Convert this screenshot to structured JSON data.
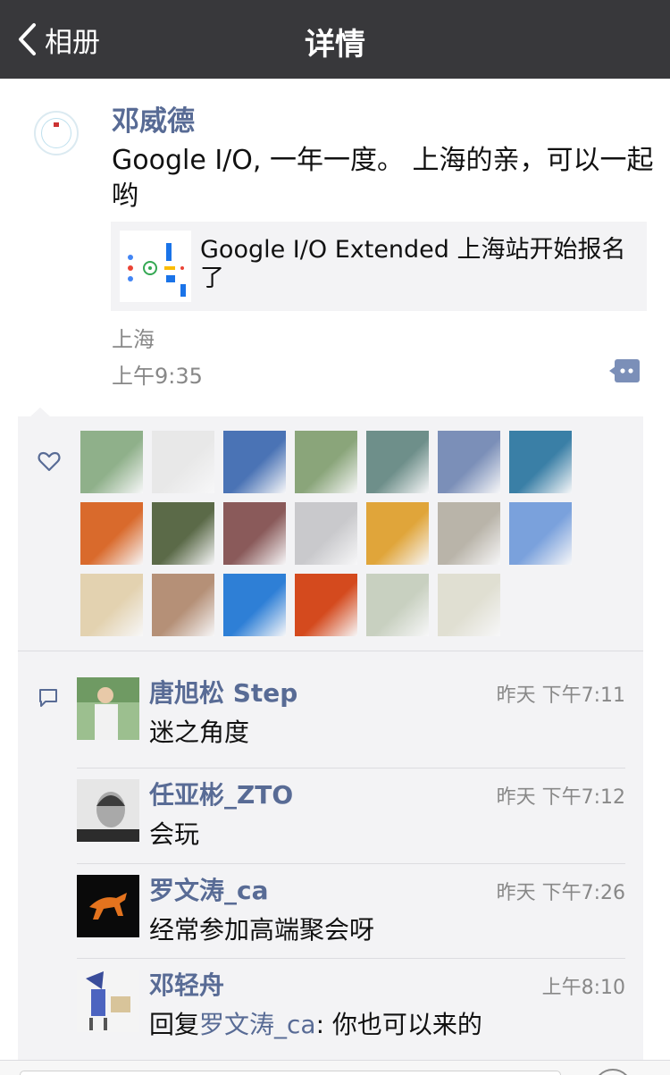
{
  "nav": {
    "back_label": "相册",
    "title": "详情"
  },
  "post": {
    "author": "邓威德",
    "text": "Google I/O, 一年一度。 上海的亲，可以一起哟",
    "link_title": "Google I/O Extended 上海站开始报名了",
    "location": "上海",
    "time": "上午9:35"
  },
  "likes": {
    "avatars": [
      "#8fb08a",
      "#e8e8e8",
      "#4a73b5",
      "#8aa57a",
      "#6e8f8a",
      "#7b8fb8",
      "#3a7fa6",
      "#d96a2c",
      "#5b6a48",
      "#8a5a5a",
      "#c9c9cc",
      "#e0a53a",
      "#b9b4a9",
      "#7aa1dc",
      "#e3d2b0",
      "#b59077",
      "#2e7fd6",
      "#d44a1e",
      "#c8d0c0",
      "#e0dfd2"
    ]
  },
  "comments": [
    {
      "name": "唐旭松 Step",
      "time": "昨天 下午7:11",
      "text": "迷之角度",
      "avatar_color": "#8fb08a"
    },
    {
      "name": "任亚彬_ZTO",
      "time": "昨天 下午7:12",
      "text": "会玩",
      "avatar_color": "#bdbdbd"
    },
    {
      "name": "罗文涛_ca",
      "time": "昨天 下午7:26",
      "text": "经常参加高端聚会呀",
      "avatar_color": "#111111"
    },
    {
      "name": "邓轻舟",
      "time": "上午8:10",
      "reply_prefix": "回复",
      "reply_to": "罗文涛_ca",
      "reply_text": ": 你也可以来的",
      "avatar_color": "#f0f0f0"
    }
  ]
}
